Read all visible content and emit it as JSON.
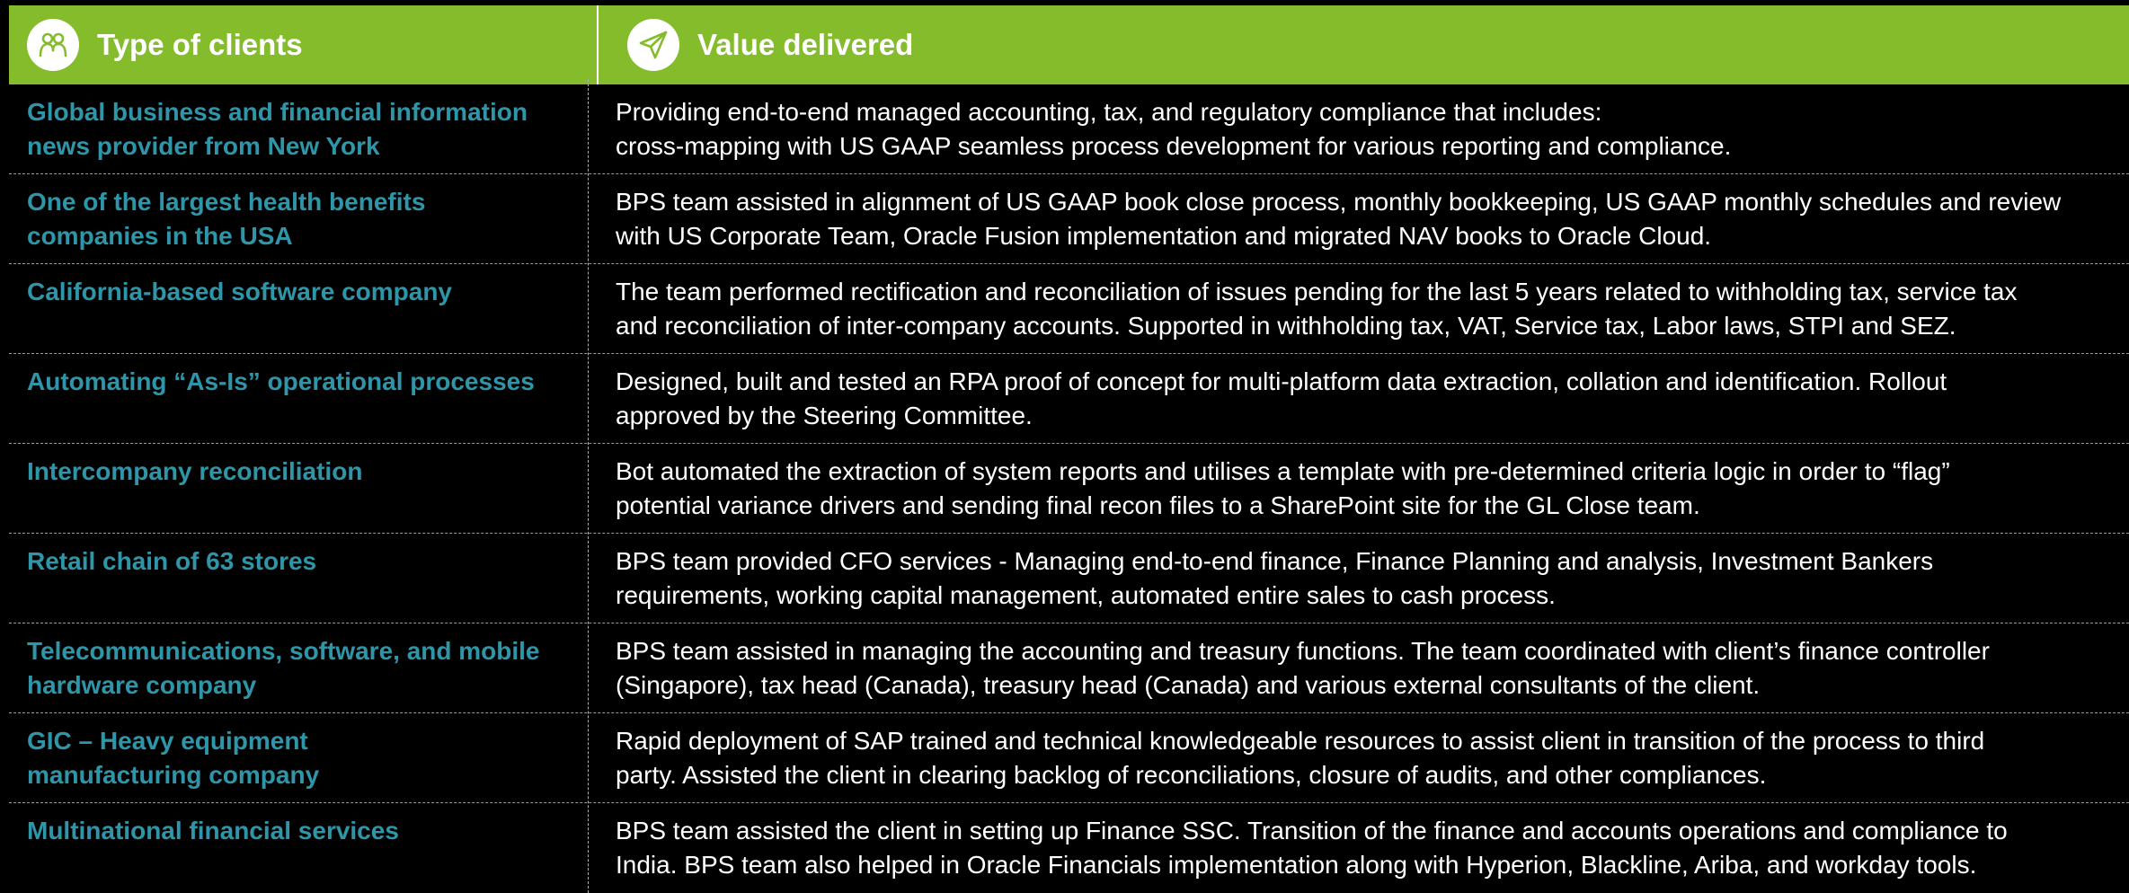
{
  "header": {
    "col1_label": "Type of clients",
    "col2_label": "Value delivered",
    "col1_icon": "people-icon",
    "col2_icon": "paper-plane-icon",
    "bg_color": "#84bc2c"
  },
  "colors": {
    "client_text": "#2e96a8",
    "value_text": "#ffffff",
    "background": "#000000"
  },
  "rows": [
    {
      "client": [
        "Global business and financial information",
        "news provider from New York"
      ],
      "value": [
        "Providing end-to-end managed accounting, tax, and regulatory compliance that includes:",
        "cross-mapping with US GAAP seamless process development for various reporting and compliance."
      ]
    },
    {
      "client": [
        "One of the largest health benefits",
        "companies in the USA"
      ],
      "value": [
        "BPS team assisted in alignment of US GAAP book close process, monthly bookkeeping, US GAAP monthly schedules and review",
        "with US Corporate Team, Oracle Fusion implementation and migrated NAV books to Oracle Cloud."
      ]
    },
    {
      "client": [
        "California-based software company"
      ],
      "value": [
        "The team performed rectification and reconciliation of issues pending for the last 5 years related to withholding tax, service tax",
        "and reconciliation of inter-company accounts. Supported in withholding tax, VAT, Service tax, Labor laws, STPI and SEZ."
      ]
    },
    {
      "client": [
        "Automating “As-Is” operational processes"
      ],
      "value": [
        "Designed, built and tested an RPA proof of concept for multi-platform data extraction, collation and identification. Rollout",
        "approved by the Steering Committee."
      ]
    },
    {
      "client": [
        "Intercompany reconciliation"
      ],
      "value": [
        "Bot automated the extraction of system reports and utilises a template with pre-determined criteria logic in order to “flag”",
        "potential variance drivers and sending final recon files to a SharePoint site for the GL Close team."
      ]
    },
    {
      "client": [
        "Retail chain of 63 stores"
      ],
      "value": [
        "BPS team provided CFO services - Managing end-to-end finance, Finance Planning and analysis, Investment Bankers",
        "requirements, working capital management, automated entire sales to cash process."
      ]
    },
    {
      "client": [
        "Telecommunications, software, and mobile",
        "hardware company"
      ],
      "value": [
        "BPS team assisted in managing the accounting and treasury functions. The team coordinated with client’s finance controller",
        "(Singapore), tax head (Canada), treasury head (Canada) and various external consultants of the client."
      ]
    },
    {
      "client": [
        "GIC – Heavy equipment",
        "manufacturing company"
      ],
      "value": [
        "Rapid deployment of SAP trained and technical knowledgeable resources to assist client in transition of the process to third",
        "party. Assisted the client in clearing backlog of reconciliations, closure of audits, and other compliances."
      ]
    },
    {
      "client": [
        "Multinational financial services"
      ],
      "value": [
        "BPS team assisted the client in setting up Finance SSC. Transition of the finance and accounts operations and compliance to",
        "India. BPS team also helped in Oracle Financials implementation along with Hyperion, Blackline, Ariba, and workday tools."
      ]
    }
  ]
}
